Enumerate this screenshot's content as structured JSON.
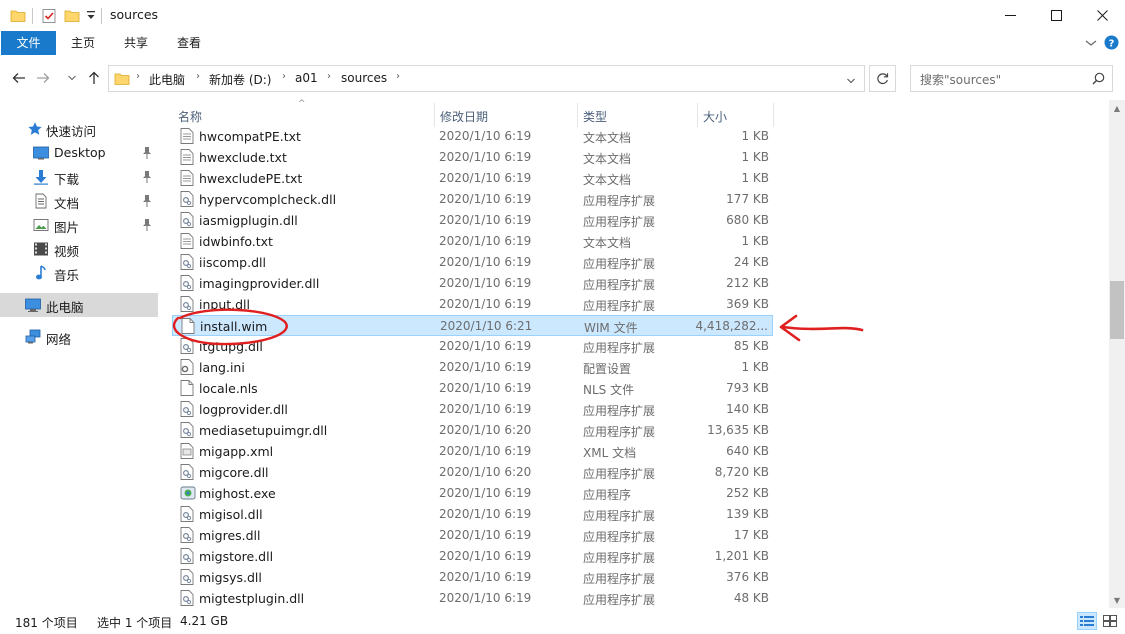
{
  "window": {
    "title": "sources",
    "quick_access_icons": [
      "folder-icon",
      "properties-icon",
      "new-folder-icon",
      "customize-dropdown-icon"
    ]
  },
  "ribbon": {
    "tabs": [
      "文件",
      "主页",
      "共享",
      "查看"
    ]
  },
  "address": {
    "breadcrumbs": [
      "此电脑",
      "新加卷 (D:)",
      "a01",
      "sources"
    ],
    "search_placeholder": "搜索\"sources\""
  },
  "nav_pane": {
    "items": [
      {
        "label": "快速访问",
        "icon": "star-icon",
        "pinned": false
      },
      {
        "label": "Desktop",
        "icon": "desktop-icon",
        "pinned": true
      },
      {
        "label": "下载",
        "icon": "download-icon",
        "pinned": true
      },
      {
        "label": "文档",
        "icon": "document-icon",
        "pinned": true
      },
      {
        "label": "图片",
        "icon": "pictures-icon",
        "pinned": true
      },
      {
        "label": "视频",
        "icon": "video-icon",
        "pinned": false
      },
      {
        "label": "音乐",
        "icon": "music-icon",
        "pinned": false
      },
      {
        "label": "此电脑",
        "icon": "this-pc-icon",
        "pinned": false,
        "selected": true
      },
      {
        "label": "网络",
        "icon": "network-icon",
        "pinned": false
      }
    ]
  },
  "file_list": {
    "columns": [
      "名称",
      "修改日期",
      "类型",
      "大小"
    ],
    "rows": [
      {
        "name": "hwcompatPE.txt",
        "date": "2020/1/10 6:19",
        "type": "文本文档",
        "size": "1 KB",
        "icon": "text-file-icon"
      },
      {
        "name": "hwexclude.txt",
        "date": "2020/1/10 6:19",
        "type": "文本文档",
        "size": "1 KB",
        "icon": "text-file-icon"
      },
      {
        "name": "hwexcludePE.txt",
        "date": "2020/1/10 6:19",
        "type": "文本文档",
        "size": "1 KB",
        "icon": "text-file-icon"
      },
      {
        "name": "hypervcomplcheck.dll",
        "date": "2020/1/10 6:19",
        "type": "应用程序扩展",
        "size": "177 KB",
        "icon": "dll-file-icon"
      },
      {
        "name": "iasmigplugin.dll",
        "date": "2020/1/10 6:19",
        "type": "应用程序扩展",
        "size": "680 KB",
        "icon": "dll-file-icon"
      },
      {
        "name": "idwbinfo.txt",
        "date": "2020/1/10 6:19",
        "type": "文本文档",
        "size": "1 KB",
        "icon": "text-file-icon"
      },
      {
        "name": "iiscomp.dll",
        "date": "2020/1/10 6:19",
        "type": "应用程序扩展",
        "size": "24 KB",
        "icon": "dll-file-icon"
      },
      {
        "name": "imagingprovider.dll",
        "date": "2020/1/10 6:19",
        "type": "应用程序扩展",
        "size": "212 KB",
        "icon": "dll-file-icon"
      },
      {
        "name": "input.dll",
        "date": "2020/1/10 6:19",
        "type": "应用程序扩展",
        "size": "369 KB",
        "icon": "dll-file-icon"
      },
      {
        "name": "install.wim",
        "date": "2020/1/10 6:21",
        "type": "WIM 文件",
        "size": "4,418,282...",
        "icon": "blank-file-icon",
        "selected": true
      },
      {
        "name": "itgtupg.dll",
        "date": "2020/1/10 6:19",
        "type": "应用程序扩展",
        "size": "85 KB",
        "icon": "dll-file-icon"
      },
      {
        "name": "lang.ini",
        "date": "2020/1/10 6:19",
        "type": "配置设置",
        "size": "1 KB",
        "icon": "ini-file-icon"
      },
      {
        "name": "locale.nls",
        "date": "2020/1/10 6:19",
        "type": "NLS 文件",
        "size": "793 KB",
        "icon": "blank-file-icon"
      },
      {
        "name": "logprovider.dll",
        "date": "2020/1/10 6:19",
        "type": "应用程序扩展",
        "size": "140 KB",
        "icon": "dll-file-icon"
      },
      {
        "name": "mediasetupuimgr.dll",
        "date": "2020/1/10 6:20",
        "type": "应用程序扩展",
        "size": "13,635 KB",
        "icon": "dll-file-icon"
      },
      {
        "name": "migapp.xml",
        "date": "2020/1/10 6:19",
        "type": "XML 文档",
        "size": "640 KB",
        "icon": "xml-file-icon"
      },
      {
        "name": "migcore.dll",
        "date": "2020/1/10 6:20",
        "type": "应用程序扩展",
        "size": "8,720 KB",
        "icon": "dll-file-icon"
      },
      {
        "name": "mighost.exe",
        "date": "2020/1/10 6:19",
        "type": "应用程序",
        "size": "252 KB",
        "icon": "exe-file-icon"
      },
      {
        "name": "migisol.dll",
        "date": "2020/1/10 6:19",
        "type": "应用程序扩展",
        "size": "139 KB",
        "icon": "dll-file-icon"
      },
      {
        "name": "migres.dll",
        "date": "2020/1/10 6:19",
        "type": "应用程序扩展",
        "size": "17 KB",
        "icon": "dll-file-icon"
      },
      {
        "name": "migstore.dll",
        "date": "2020/1/10 6:19",
        "type": "应用程序扩展",
        "size": "1,201 KB",
        "icon": "dll-file-icon"
      },
      {
        "name": "migsys.dll",
        "date": "2020/1/10 6:19",
        "type": "应用程序扩展",
        "size": "376 KB",
        "icon": "dll-file-icon"
      },
      {
        "name": "migtestplugin.dll",
        "date": "2020/1/10 6:19",
        "type": "应用程序扩展",
        "size": "48 KB",
        "icon": "dll-file-icon"
      }
    ]
  },
  "status_bar": {
    "item_count": "181 个项目",
    "selection": "选中 1 个项目",
    "selection_size": "4.21 GB"
  },
  "colors": {
    "accent": "#1979ca",
    "selection_bg": "#cce8ff",
    "selection_border": "#99d1ff",
    "annotation_red": "#e02020"
  }
}
